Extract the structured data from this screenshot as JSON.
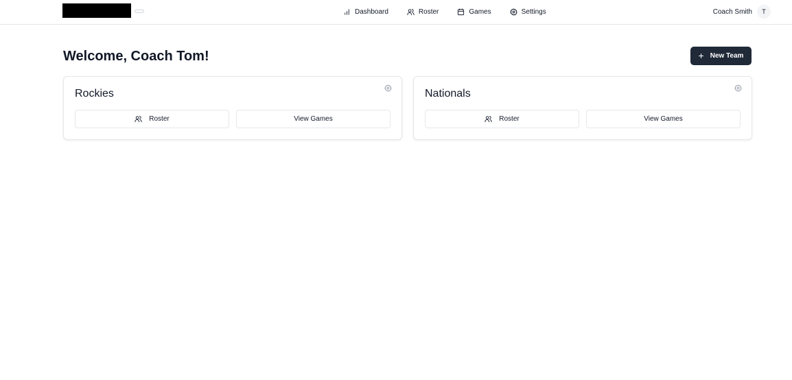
{
  "nav": {
    "items": [
      {
        "label": "Dashboard",
        "icon": "bar-chart-icon"
      },
      {
        "label": "Roster",
        "icon": "users-icon"
      },
      {
        "label": "Games",
        "icon": "calendar-icon"
      },
      {
        "label": "Settings",
        "icon": "gear-icon"
      }
    ]
  },
  "user": {
    "name": "Coach Smith",
    "initial": "T"
  },
  "page": {
    "title": "Welcome, Coach Tom!"
  },
  "actions": {
    "new_team_label": "New Team",
    "new_team_icon": "plus-icon"
  },
  "teams": [
    {
      "name": "Rockies",
      "roster_label": "Roster",
      "games_label": "View Games"
    },
    {
      "name": "Nationals",
      "roster_label": "Roster",
      "games_label": "View Games"
    }
  ],
  "colors": {
    "accent": "#1f2937",
    "border": "#e5e7eb",
    "text": "#111827",
    "icon_muted": "#9ca3af"
  }
}
